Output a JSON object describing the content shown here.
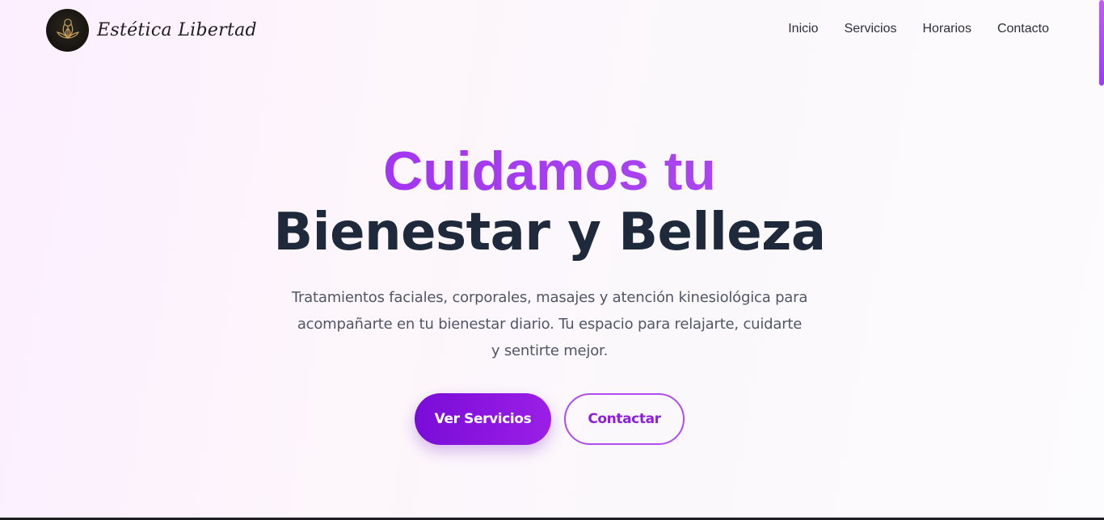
{
  "brand": {
    "name": "Estética Libertad",
    "logo_icon": "lotus-woman-logo-icon"
  },
  "nav": {
    "items": [
      {
        "label": "Inicio"
      },
      {
        "label": "Servicios"
      },
      {
        "label": "Horarios"
      },
      {
        "label": "Contacto"
      }
    ]
  },
  "hero": {
    "headline_accent": "Cuidamos tu",
    "headline_main": "Bienestar y Belleza",
    "subtitle": "Tratamientos faciales, corporales, masajes y atención kinesiológica para acompañarte en tu bienestar diario. Tu espacio para relajarte, cuidarte y sentirte mejor.",
    "primary_button": "Ver Servicios",
    "secondary_button": "Contactar"
  },
  "colors": {
    "accent": "#9b25ee",
    "primary_button": "#8a12df",
    "heading_dark": "#1e2a3c",
    "body_text": "#505666"
  }
}
